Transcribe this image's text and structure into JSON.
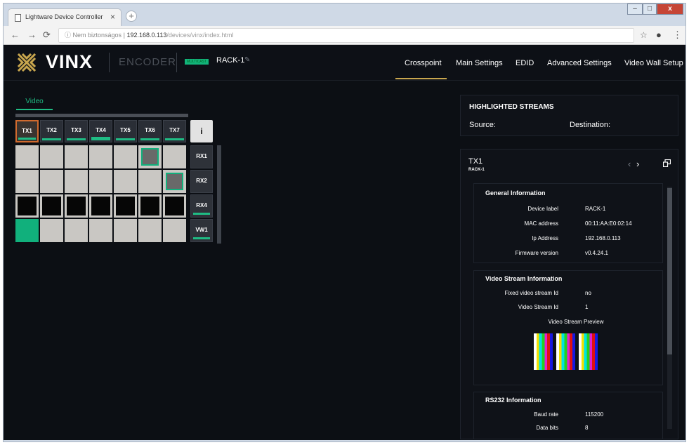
{
  "browser": {
    "tab_title": "Lightware Device Controller",
    "tab_close": "×",
    "new_tab": "+",
    "url_secure_label": "Nem biztonságos",
    "url_separator": "|",
    "url_host": "192.168.0.113",
    "url_path": "/devices/vinx/index.html",
    "window_minimize": "–",
    "window_maximize": "□",
    "window_close": "x"
  },
  "header": {
    "logo_text": "VINX",
    "mode": "ENCODER",
    "multi_badge": "MULTICAST",
    "device_label": "RACK-1",
    "menu": [
      "Crosspoint",
      "Main Settings",
      "EDID",
      "Advanced Settings",
      "Video Wall Setup"
    ],
    "active_menu": "Crosspoint",
    "accent_color": "#c8a64e"
  },
  "crosspoint": {
    "tab_label": "Video",
    "transmitters": [
      "TX1",
      "TX2",
      "TX3",
      "TX4",
      "TX5",
      "TX6",
      "TX7"
    ],
    "selected_transmitter": "TX1",
    "receivers": [
      "RX1",
      "RX2",
      "RX4",
      "VW1"
    ],
    "info_icon": "info-icon",
    "green_color": "#11b07c"
  },
  "highlighted_streams": {
    "title": "HIGHLIGHTED STREAMS",
    "source_label": "Source:",
    "destination_label": "Destination:"
  },
  "detail": {
    "title": "TX1",
    "subtitle": "RACK-1",
    "general": {
      "title": "General Information",
      "rows": [
        {
          "key": "Device label",
          "value": "RACK-1"
        },
        {
          "key": "MAC address",
          "value": "00:11:AA:E0:02:14"
        },
        {
          "key": "Ip Address",
          "value": "192.168.0.113"
        },
        {
          "key": "Firmware version",
          "value": "v0.4.24.1"
        }
      ]
    },
    "video_stream": {
      "title": "Video Stream Information",
      "rows": [
        {
          "key": "Fixed video stream Id",
          "value": "no"
        },
        {
          "key": "Video Stream Id",
          "value": "1"
        }
      ],
      "preview_label": "Video Stream Preview"
    },
    "rs232": {
      "title": "RS232 Information",
      "rows": [
        {
          "key": "Baud rate",
          "value": "115200"
        },
        {
          "key": "Data bits",
          "value": "8"
        }
      ]
    }
  }
}
